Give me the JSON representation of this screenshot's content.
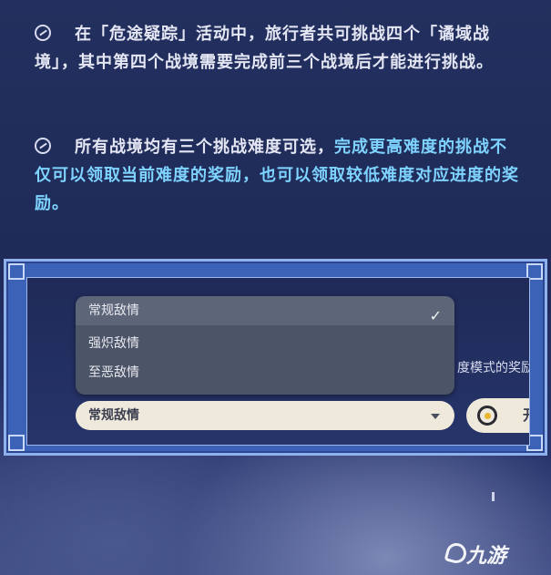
{
  "info": {
    "para1": "在「危途疑踪」活动中，旅行者共可挑战四个「谲域战境」，其中第四个战境需要完成前三个战境后才能进行挑战。",
    "para2_plain": "所有战境均有三个挑战难度可选，",
    "para2_highlight": "完成更高难度的挑战不仅可以领取当前难度的奖励，也可以领取较低难度对应进度的奖励。"
  },
  "difficulty": {
    "options": [
      "常规敌情",
      "强炽敌情",
      "至恶敌情"
    ],
    "selected": "常规敌情",
    "reward_hint": "度模式的奖励",
    "start_label": "开"
  },
  "watermark": "九游",
  "colors": {
    "highlight": "#7fd3ff",
    "frame": "#3b62b6",
    "dropdown": "#4c5468"
  },
  "icons": [
    "bullet-compass-icon",
    "check-icon",
    "chevron-down-icon",
    "start-ring-icon",
    "watermark-logo-icon"
  ]
}
